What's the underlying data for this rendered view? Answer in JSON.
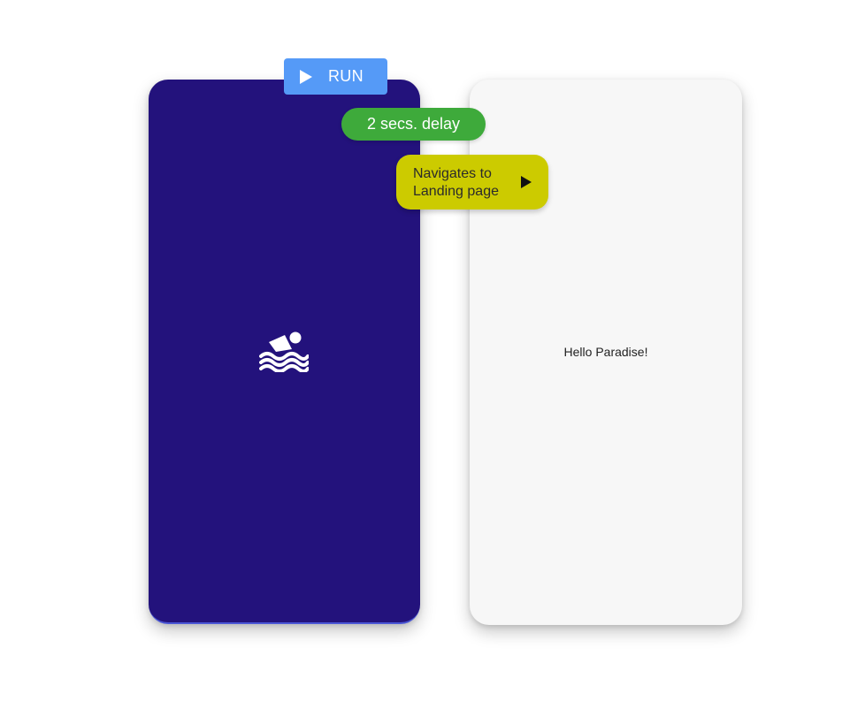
{
  "run_button": {
    "label": "RUN",
    "icon": "play-icon"
  },
  "delay": {
    "label": "2 secs. delay"
  },
  "navigate": {
    "line1": "Navigates to",
    "line2": "Landing page",
    "icon": "play-icon"
  },
  "splash_screen": {
    "icon": "swimming-icon",
    "background": "#23127c"
  },
  "landing_screen": {
    "text": "Hello Paradise!",
    "background": "#f7f7f7"
  },
  "colors": {
    "run": "#559af7",
    "delay": "#3eaa3b",
    "navigate": "#cccb00"
  }
}
